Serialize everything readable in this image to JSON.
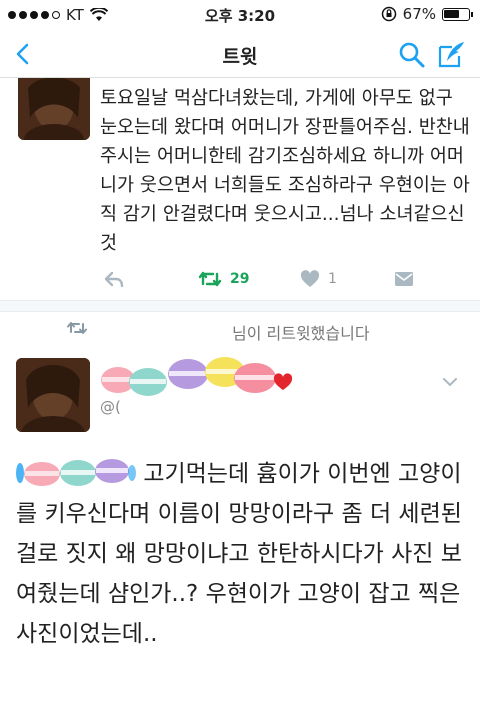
{
  "status_bar": {
    "carrier": "KT",
    "time": "오후 3:20",
    "battery": "67%",
    "battery_level": 0.67
  },
  "nav": {
    "title": "트윗"
  },
  "tweet1": {
    "text": "토요일날 먹삼다녀왔는데, 가게에 아무도 없구 눈오는데 왔다며 어머니가 장판틀어주심. 반찬내주시는 어머니한테 감기조심하세요 하니까 어머니가 웃으면서 너희들도 조심하라구 우현이는 아직 감기 안걸렸다며 웃으시고...넘나 소녀같으신것",
    "retweets": "29",
    "likes": "1"
  },
  "retweet_context": {
    "text": "님이 리트윗했습니다"
  },
  "tweet2": {
    "handle": "@(",
    "text": "고기먹는데 흄이가 이번엔 고양이를 키우신다며 이름이 망망이라구 좀 더 세련된걸로 짓지 왜 망망이냐고 한탄하시다가 사진 보여줬는데 샴인가..? 우현이가 고양이 잡고 찍은 사진이었는데.."
  },
  "colors": {
    "accent": "#1da1f2",
    "retweet_green": "#19a35b",
    "icon_gray": "#aab8c2"
  }
}
